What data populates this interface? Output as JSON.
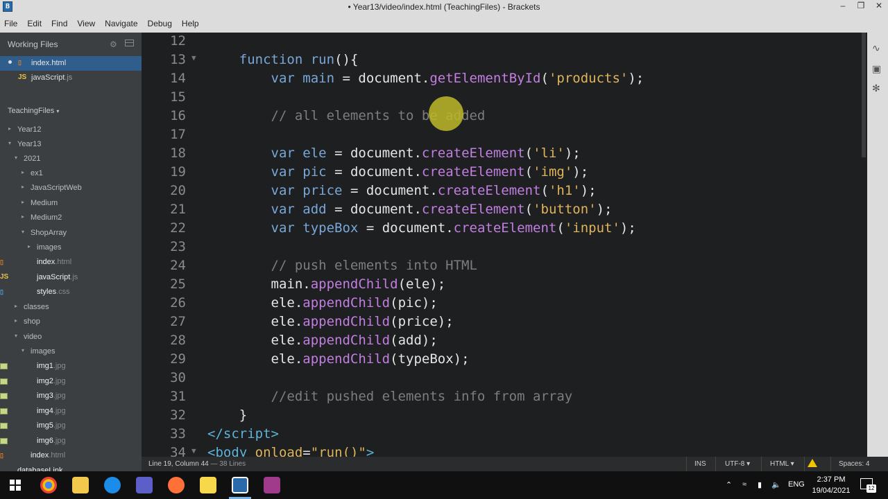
{
  "window": {
    "title": "• Year13/video/index.html (TeachingFiles) - Brackets",
    "app_icon": "B"
  },
  "menu": [
    "File",
    "Edit",
    "Find",
    "View",
    "Navigate",
    "Debug",
    "Help"
  ],
  "sidebar": {
    "working_files_title": "Working Files",
    "working_files": [
      {
        "name": "index",
        "ext": ".html",
        "active": true
      },
      {
        "name": "javaScript",
        "ext": ".js",
        "active": false
      }
    ],
    "project_title": "TeachingFiles",
    "tree": [
      {
        "label": "Year12",
        "ext": ""
      },
      {
        "label": "Year13",
        "ext": ""
      },
      {
        "label": "2021",
        "ext": ""
      },
      {
        "label": "ex1",
        "ext": ""
      },
      {
        "label": "JavaScriptWeb",
        "ext": ""
      },
      {
        "label": "Medium",
        "ext": ""
      },
      {
        "label": "Medium2",
        "ext": ""
      },
      {
        "label": "ShopArray",
        "ext": ""
      },
      {
        "label": "images",
        "ext": ""
      },
      {
        "label": "index",
        "ext": ".html"
      },
      {
        "label": "javaScript",
        "ext": ".js"
      },
      {
        "label": "styles",
        "ext": ".css"
      },
      {
        "label": "classes",
        "ext": ""
      },
      {
        "label": "shop",
        "ext": ""
      },
      {
        "label": "video",
        "ext": ""
      },
      {
        "label": "images",
        "ext": ""
      },
      {
        "label": "img1",
        "ext": ".jpg"
      },
      {
        "label": "img2",
        "ext": ".jpg"
      },
      {
        "label": "img3",
        "ext": ".jpg"
      },
      {
        "label": "img4",
        "ext": ".jpg"
      },
      {
        "label": "img5",
        "ext": ".jpg"
      },
      {
        "label": "img6",
        "ext": ".jpg"
      },
      {
        "label": "index",
        "ext": ".html"
      },
      {
        "label": "databaseLink",
        "ext": ""
      }
    ]
  },
  "editor": {
    "line_numbers": [
      "12",
      "13",
      "14",
      "15",
      "16",
      "17",
      "18",
      "19",
      "20",
      "21",
      "22",
      "23",
      "24",
      "25",
      "26",
      "27",
      "28",
      "29",
      "30",
      "31",
      "32",
      "33",
      "34"
    ]
  },
  "statusbar": {
    "position": "Line 19, Column 44",
    "lines": "— 38 Lines",
    "ins": "INS",
    "encoding": "UTF-8 ▾",
    "language": "HTML ▾",
    "spaces": "Spaces: 4"
  },
  "taskbar": {
    "lang": "ENG",
    "time": "2:37 PM",
    "date": "19/04/2021",
    "notifications": "12"
  }
}
